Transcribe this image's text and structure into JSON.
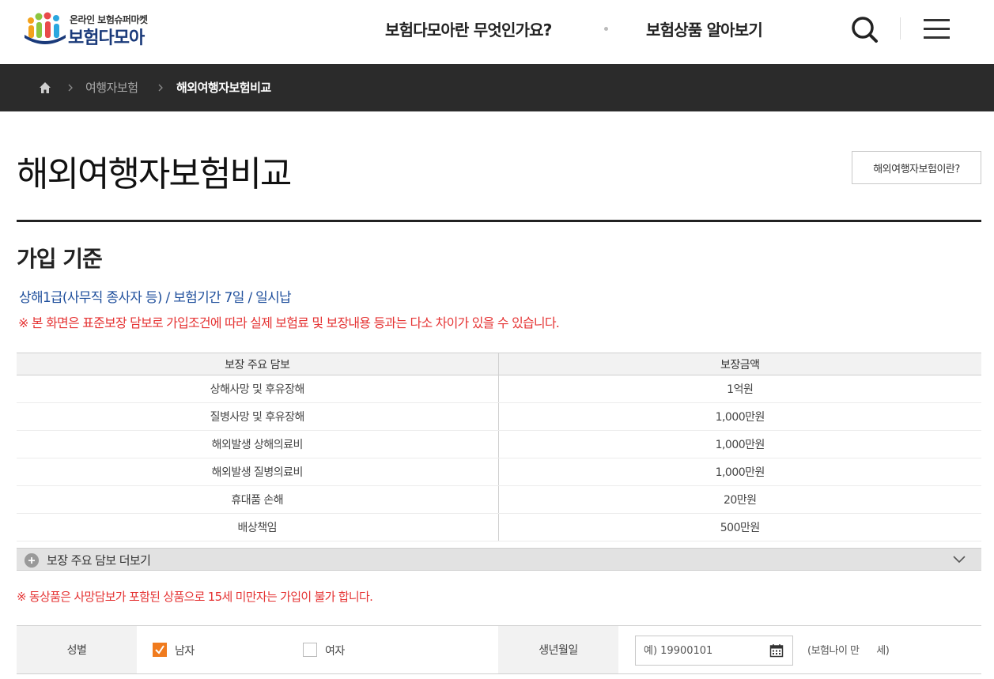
{
  "header": {
    "logo_sub": "온라인 보험슈퍼마켓",
    "logo_main": "보험다모아",
    "nav": [
      {
        "label": "보험다모아란 무엇인가요?"
      },
      {
        "label": "보험상품 알아보기"
      }
    ],
    "icons": {
      "search": "search-icon",
      "menu": "hamburger-icon"
    }
  },
  "breadcrumb": {
    "items": [
      {
        "label": "여행자보험"
      },
      {
        "label": "해외여행자보험비교"
      }
    ]
  },
  "page": {
    "title": "해외여행자보험비교",
    "info_button": "해외여행자보험이란?"
  },
  "section": {
    "title": "가입 기준",
    "criteria": "상해1급(사무직 종사자 등) / 보험기간 7일 / 일시납",
    "notice": "※ 본 화면은 표준보장 담보로 가입조건에 따라 실제 보험료 및 보장내용 등과는 다소 차이가 있을 수 있습니다."
  },
  "coverage_table": {
    "headers": [
      "보장 주요 담보",
      "보장금액"
    ],
    "rows": [
      {
        "item": "상해사망 및 후유장해",
        "amount": "1억원"
      },
      {
        "item": "질병사망 및 후유장해",
        "amount": "1,000만원"
      },
      {
        "item": "해외발생 상해의료비",
        "amount": "1,000만원"
      },
      {
        "item": "해외발생 질병의료비",
        "amount": "1,000만원"
      },
      {
        "item": "휴대품 손해",
        "amount": "20만원"
      },
      {
        "item": "배상책임",
        "amount": "500만원"
      }
    ],
    "more_label": "보장 주요 담보 더보기"
  },
  "age_notice": "※ 동상품은 사망담보가 포함된 상품으로 15세 미만자는 가입이 불가 합니다.",
  "form": {
    "gender_label": "성별",
    "male": "남자",
    "female": "여자",
    "male_checked": true,
    "female_checked": false,
    "birth_label": "생년월일",
    "birth_placeholder": "예) 19900101",
    "age_text": "(보험나이 만      세)"
  },
  "colors": {
    "breadcrumb_bg": "#2b2b2b",
    "criteria_blue": "#1f4f9c",
    "notice_red": "#e53333",
    "checkbox_orange": "#f07b1e"
  }
}
